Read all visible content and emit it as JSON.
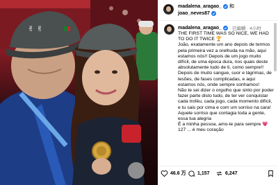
{
  "header": {
    "author": "madalena_aragao_",
    "join_word": "和",
    "coauthor": "joao_neves87"
  },
  "post": {
    "author": "madalena_aragao_",
    "meta": "· 已編輯 · 4小时",
    "caption": "THE FIRST TIME WAS SO NICE, WE HAD TO DO IT TWICE 🏆\nJoão, exatamente um ano depois de termos pela primeira vez a orelhuda na mão, aqui estamos nós!! Depois de um jogo muito difícil, de uma época dura, nos quais deste absolutamente tudo de ti, como sempre!! Depois de muito sangue, suor e lágrimas, de lesões, de fases complicadas, e aqui estamos nós, onde sempre sonhamos!\nNão te sei dizer o orgulho que sinto por poder fazer parte disto tudo, de ter ver conquistar cada troféu, cada jogo, cada momento difícil, e tu sais por cima e com um sorriso na cara! Aquele sorriso que contagia toda a gente, essa tua alegria\nÉ a minha pessoa, amo-te para sempre 💗 127 ... é meu coração"
  },
  "actions": {
    "likes": "46.6 万",
    "comments": "1,157",
    "shares": "6,247"
  },
  "icons": {
    "verified": "verified-badge-icon",
    "like": "heart-icon",
    "comment": "comment-bubble-icon",
    "share": "share-arrows-icon",
    "save": "bookmark-icon"
  },
  "colors": {
    "verified": "#1877f2",
    "meta_gray": "#737373",
    "divider": "#efefef"
  }
}
